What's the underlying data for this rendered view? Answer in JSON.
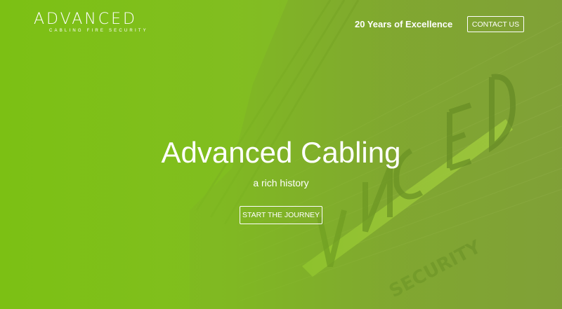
{
  "brand": {
    "logo_text": "ADVANCED",
    "logo_subtext": "CABLING FIRE SECURITY"
  },
  "header": {
    "tagline": "20 Years of Excellence",
    "contact_label": "CONTACT US"
  },
  "hero": {
    "title": "Advanced Cabling",
    "subtitle": "a rich history",
    "cta_label": "START THE JOURNEY",
    "sign_letters": "ADVANCED",
    "sign_sub": "SECURITY"
  },
  "colors": {
    "primary_green": "#7fc21a",
    "text": "#ffffff"
  }
}
